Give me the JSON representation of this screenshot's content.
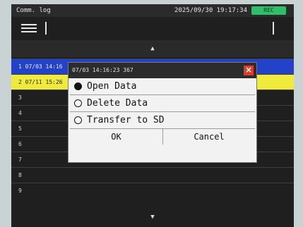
{
  "header": {
    "title": "Comm. log",
    "datetime": "2025/09/30 19:17:34",
    "rec_badge": "REC"
  },
  "icons": {
    "menu": "hamburger-menu-icon",
    "up": "triangle-up-icon",
    "down": "triangle-down-icon",
    "close": "close-icon"
  },
  "arrows": {
    "up": "▲",
    "down": "▼"
  },
  "colors": {
    "selected_row_blue": "#2243c9",
    "selected_row_yellow": "#f0ea3c",
    "rec_green": "#2fbf6a",
    "close_red": "#e33a2a"
  },
  "list": {
    "rows": [
      {
        "label": "1 07/03 14:16"
      },
      {
        "label": "2 07/11 15:26"
      },
      {
        "label": "3"
      },
      {
        "label": "4"
      },
      {
        "label": "5"
      },
      {
        "label": "6"
      },
      {
        "label": "7"
      },
      {
        "label": "8"
      },
      {
        "label": "9"
      }
    ]
  },
  "dialog": {
    "title": "07/03 14:16:23 367",
    "close": "×",
    "options": [
      {
        "label": "Open Data",
        "selected": true
      },
      {
        "label": "Delete Data",
        "selected": false
      },
      {
        "label": "Transfer to SD",
        "selected": false
      }
    ],
    "ok_label": "OK",
    "cancel_label": "Cancel"
  }
}
